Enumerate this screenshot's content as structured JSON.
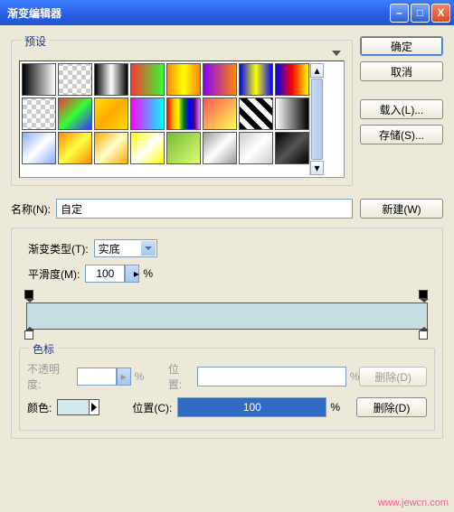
{
  "window": {
    "title": "渐变编辑器",
    "min_icon": "–",
    "max_icon": "□",
    "close_icon": "X"
  },
  "presets": {
    "legend": "预设",
    "gradients": [
      "linear-gradient(90deg,#000,#fff)",
      "repeating-conic-gradient(#ccc 0 25%,#fff 0 50%) 0/10px 10px",
      "linear-gradient(90deg,#000,#fff,#000)",
      "linear-gradient(90deg,#f33,#3f3)",
      "linear-gradient(90deg,#f80,#ff0,#f80)",
      "linear-gradient(90deg,#80f,#f80)",
      "linear-gradient(90deg,#00f,#ff0,#00f)",
      "linear-gradient(90deg,#00f,#f00,#ff0)",
      "repeating-conic-gradient(#ccc 0 25%,#fff 0 50%) 0/10px 10px",
      "linear-gradient(135deg,#f33,#3f3,#33f)",
      "linear-gradient(135deg,#fd0,#fa0,#fd0)",
      "linear-gradient(90deg,#f0f,#0ff)",
      "linear-gradient(90deg,red,orange,yellow,green,blue,indigo,violet)",
      "linear-gradient(135deg,#f55,#ff5)",
      "repeating-linear-gradient(45deg,#000 0 6px,#fff 6px 12px)",
      "linear-gradient(90deg,#fff,#000)",
      "linear-gradient(135deg,#8af,#fff,#8af)",
      "linear-gradient(135deg,#f80,#ff4,#f80)",
      "linear-gradient(135deg,#fa0,#ffc,#fa0)",
      "linear-gradient(135deg,#ff0,#fff,#ff0)",
      "linear-gradient(135deg,#7b3,#df7)",
      "linear-gradient(135deg,#999,#fff,#999)",
      "linear-gradient(135deg,#ccc,#fff,#ccc)",
      "linear-gradient(135deg,#000,#555,#000)"
    ]
  },
  "buttons": {
    "ok": "确定",
    "cancel": "取消",
    "load": "载入(L)...",
    "save": "存储(S)...",
    "new": "新建(W)"
  },
  "name": {
    "label": "名称(N):",
    "value": "自定"
  },
  "gradient": {
    "type_label": "渐变类型(T):",
    "type_value": "实底",
    "smoothness_label": "平滑度(M):",
    "smoothness_value": "100",
    "percent": "%"
  },
  "stops": {
    "legend": "色标",
    "opacity_label": "不透明度:",
    "opacity_value": "",
    "opacity_pos_label": "位置:",
    "opacity_pos_value": "",
    "opacity_delete": "删除(D)",
    "color_label": "颜色:",
    "color_value": "#d7e8ec",
    "color_pos_label": "位置(C):",
    "color_pos_value": "100",
    "color_delete": "删除(D)"
  },
  "watermark": "www.jewcn.com"
}
